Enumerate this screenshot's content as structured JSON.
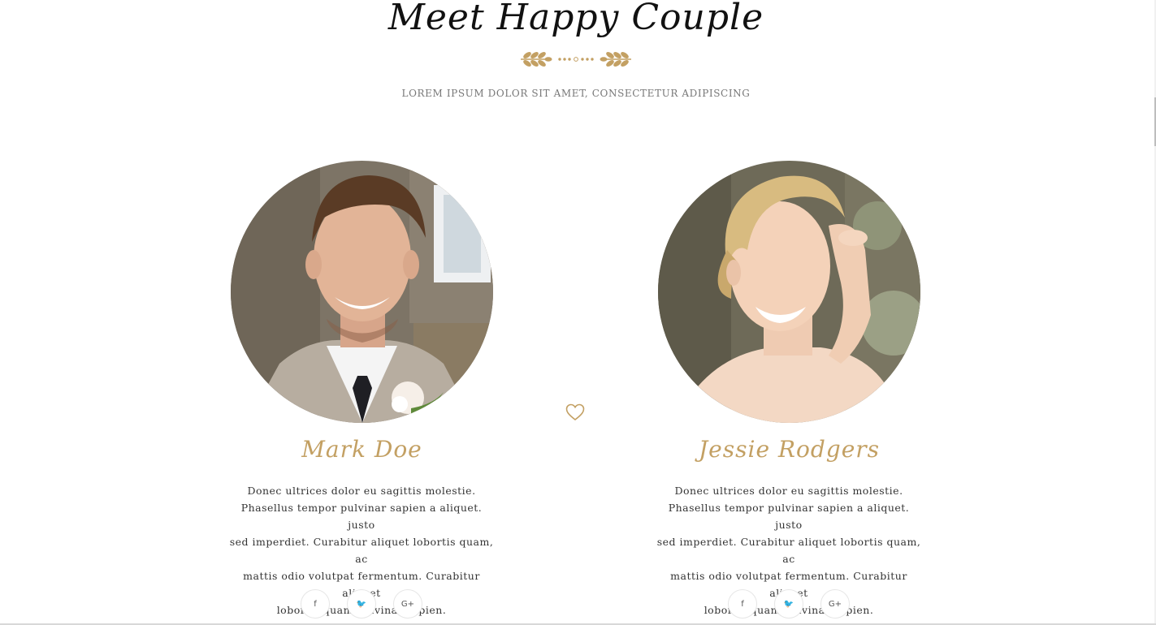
{
  "section": {
    "title": "Meet Happy Couple",
    "subtitle": "LOREM IPSUM DOLOR SIT AMET, CONSECTETUR ADIPISCING"
  },
  "colors": {
    "accent_gold": "#c3a063",
    "heading_text": "#111111",
    "body_text": "#333333",
    "muted_text": "#777777"
  },
  "groom": {
    "name": "Mark Doe",
    "bio_lines": [
      "Donec ultrices dolor eu sagittis molestie.",
      "Phasellus tempor pulvinar sapien a aliquet. justo",
      "sed imperdiet. Curabitur aliquet lobortis quam, ac",
      "mattis odio volutpat fermentum. Curabitur aliquet",
      "lobortis quam pulvinar sapien."
    ],
    "socials": {
      "facebook": "f",
      "twitter": "🐦",
      "google_plus": "G+"
    }
  },
  "bride": {
    "name": "Jessie Rodgers",
    "bio_lines": [
      "Donec ultrices dolor eu sagittis molestie.",
      "Phasellus tempor pulvinar sapien a aliquet. justo",
      "sed imperdiet. Curabitur aliquet lobortis quam, ac",
      "mattis odio volutpat fermentum. Curabitur aliquet",
      "lobortis quam pulvinar sapien."
    ],
    "socials": {
      "facebook": "f",
      "twitter": "🐦",
      "google_plus": "G+"
    }
  },
  "icons": {
    "ornament": "laurel-divider-icon",
    "divider_heart": "heart-icon",
    "facebook": "facebook-icon",
    "twitter": "twitter-icon",
    "google_plus": "google-plus-icon"
  }
}
